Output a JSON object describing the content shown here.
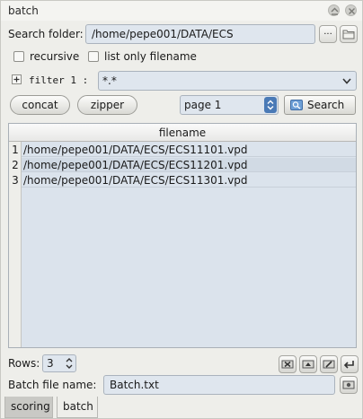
{
  "window": {
    "title": "batch"
  },
  "search": {
    "folder_label": "Search folder:",
    "folder_value": "/home/pepe001/DATA/ECS",
    "browse_label": "...",
    "recursive_label": "recursive",
    "list_only_label": "list only filename",
    "filter_label": "filter 1 :",
    "filter_value": "*.*"
  },
  "actions": {
    "concat_label": "concat",
    "zipper_label": "zipper",
    "page_value": "page 1",
    "search_label": "Search"
  },
  "table": {
    "header": "filename",
    "rows": [
      {
        "num": "1",
        "filename": "/home/pepe001/DATA/ECS/ECS11101.vpd"
      },
      {
        "num": "2",
        "filename": "/home/pepe001/DATA/ECS/ECS11201.vpd"
      },
      {
        "num": "3",
        "filename": "/home/pepe001/DATA/ECS/ECS11301.vpd"
      }
    ]
  },
  "bottom": {
    "rows_label": "Rows:",
    "rows_value": "3",
    "batch_file_label": "Batch file name:",
    "batch_file_value": "Batch.txt"
  },
  "tabs": [
    {
      "label": "scoring",
      "active": false
    },
    {
      "label": "batch",
      "active": true
    }
  ],
  "colors": {
    "field_bg": "#dfe6ee",
    "panel_bg": "#eeeeea"
  }
}
